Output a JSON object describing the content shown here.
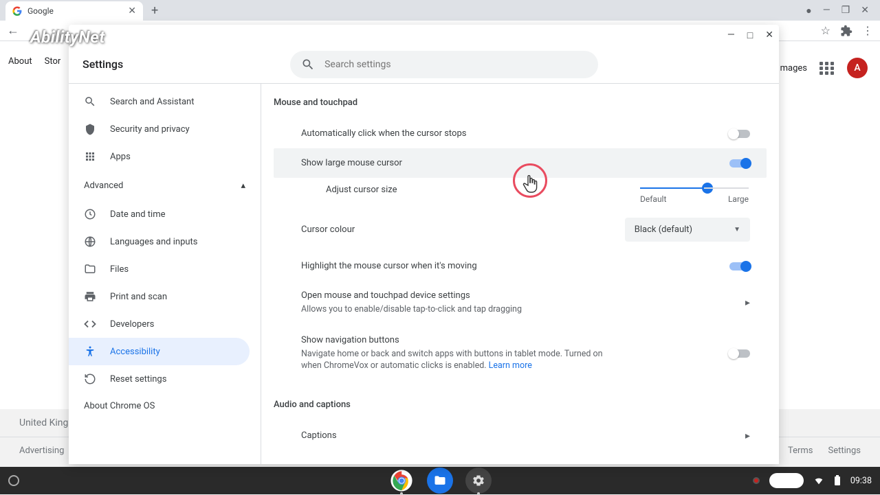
{
  "browser": {
    "tab_title": "Google",
    "nav": {
      "about": "About",
      "store": "Stor",
      "images": "mages"
    },
    "avatar_letter": "A",
    "footer": {
      "region": "United Kingd",
      "advertising": "Advertising",
      "terms": "Terms",
      "settings": "Settings"
    }
  },
  "watermark": "AbilityNet",
  "settings": {
    "title": "Settings",
    "search_placeholder": "Search settings",
    "sidebar": {
      "search_assist": "Search and Assistant",
      "security": "Security and privacy",
      "apps": "Apps",
      "advanced": "Advanced",
      "date_time": "Date and time",
      "languages": "Languages and inputs",
      "files": "Files",
      "print_scan": "Print and scan",
      "developers": "Developers",
      "accessibility": "Accessibility",
      "reset": "Reset settings",
      "about": "About Chrome OS"
    },
    "content": {
      "section_mouse": "Mouse and touchpad",
      "auto_click": "Automatically click when the cursor stops",
      "large_cursor": "Show large mouse cursor",
      "adjust_size": "Adjust cursor size",
      "slider_default": "Default",
      "slider_large": "Large",
      "cursor_colour": "Cursor colour",
      "cursor_colour_value": "Black (default)",
      "highlight_moving": "Highlight the mouse cursor when it's moving",
      "open_device": "Open mouse and touchpad device settings",
      "open_device_sub": "Allows you to enable/disable tap-to-click and tap dragging",
      "nav_buttons": "Show navigation buttons",
      "nav_buttons_sub": "Navigate home or back and switch apps with buttons in tablet mode. Turned on when ChromeVox or automatic clicks is enabled.  ",
      "learn_more": "Learn more",
      "section_audio": "Audio and captions",
      "captions": "Captions"
    }
  },
  "shelf": {
    "time": "09:38"
  }
}
